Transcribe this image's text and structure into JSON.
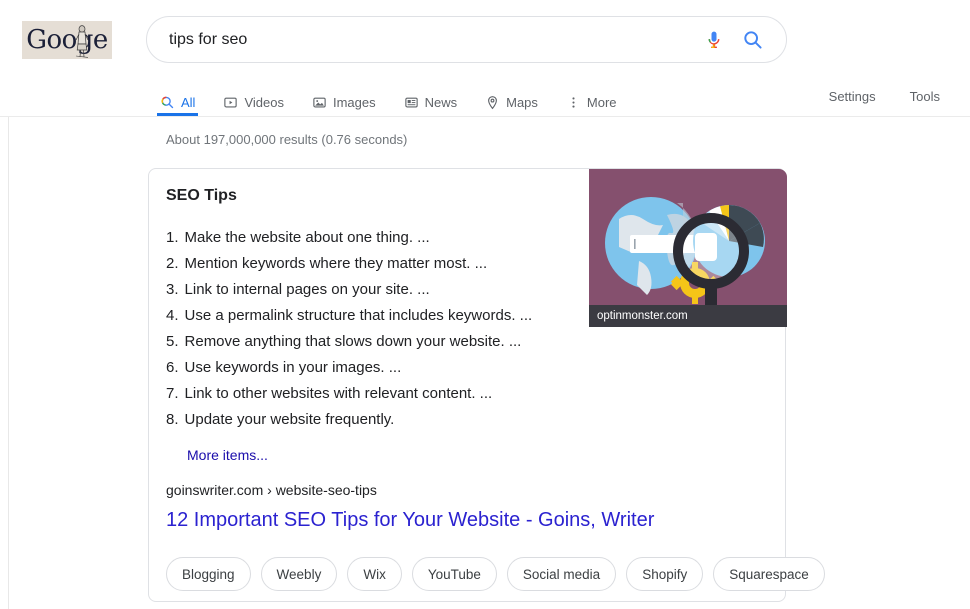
{
  "brand": {
    "logo_text": "Googe",
    "logo_doodle": "doodle-figure",
    "accent_blue": "#1a73e8",
    "link_blue": "#2b22d0"
  },
  "search": {
    "value": "tips for seo",
    "placeholder": "Search",
    "mic_icon": "microphone-icon",
    "search_icon": "search-icon"
  },
  "nav": {
    "tabs": [
      {
        "label": "All",
        "icon": "search-icon",
        "active": true
      },
      {
        "label": "Videos",
        "icon": "video-icon",
        "active": false
      },
      {
        "label": "Images",
        "icon": "image-icon",
        "active": false
      },
      {
        "label": "News",
        "icon": "news-icon",
        "active": false
      },
      {
        "label": "Maps",
        "icon": "map-pin-icon",
        "active": false
      },
      {
        "label": "More",
        "icon": "more-vertical-icon",
        "active": false
      }
    ],
    "utilities": [
      {
        "label": "Settings"
      },
      {
        "label": "Tools"
      }
    ]
  },
  "results": {
    "stats": "About 197,000,000 results (0.76 seconds)"
  },
  "featured_snippet": {
    "title": "SEO Tips",
    "items": [
      {
        "num": "1.",
        "text": "Make the website about one thing. ..."
      },
      {
        "num": "2.",
        "text": "Mention keywords where they matter most. ..."
      },
      {
        "num": "3.",
        "text": "Link to internal pages on your site. ..."
      },
      {
        "num": "4.",
        "text": "Use a permalink structure that includes keywords. ..."
      },
      {
        "num": "5.",
        "text": "Remove anything that slows down your website. ..."
      },
      {
        "num": "6.",
        "text": "Use keywords in your images. ..."
      },
      {
        "num": "7.",
        "text": "Link to other websites with relevant content. ..."
      },
      {
        "num": "8.",
        "text": "Update your website frequently."
      }
    ],
    "more_items_label": "More items...",
    "thumbnail": {
      "caption": "optinmonster.com",
      "alt": "seo-illustration",
      "bg_color": "#85506e",
      "globe_color": "#7ec4ec",
      "gear_color": "#f5c518",
      "pie_dark": "#3e4a54",
      "pie_light": "#7ec4ec",
      "pie_yellow": "#f5c518",
      "caption_bg": "#3b3b42"
    },
    "source_url": "goinswriter.com › website-seo-tips",
    "source_title": "12 Important SEO Tips for Your Website - Goins, Writer"
  },
  "related_chips": [
    "Blogging",
    "Weebly",
    "Wix",
    "YouTube",
    "Social media",
    "Shopify",
    "Squarespace"
  ]
}
